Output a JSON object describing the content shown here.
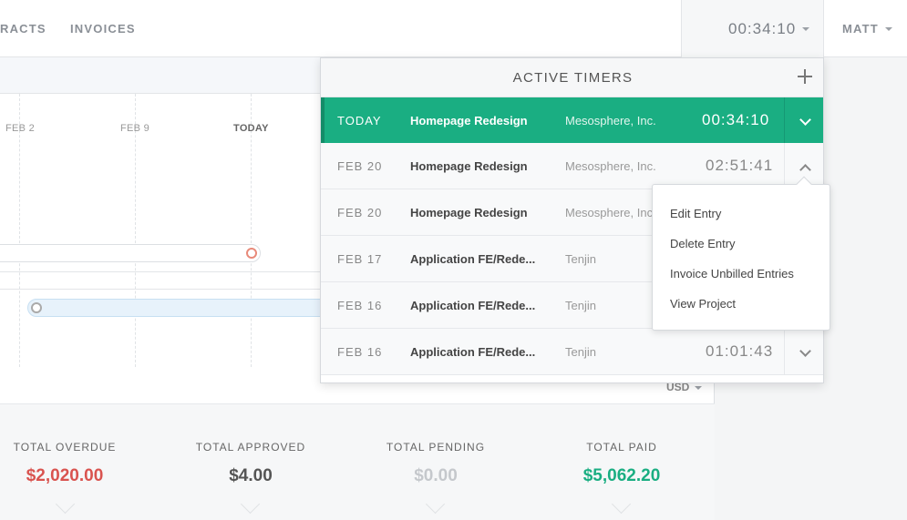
{
  "nav": {
    "contracts_label": "RACTS",
    "invoices_label": "INVOICES",
    "timer_value": "00:34:10",
    "user_label": "MATT"
  },
  "timeline": {
    "labels": [
      "FEB 2",
      "FEB 9",
      "TODAY"
    ]
  },
  "currency": "USD",
  "totals": [
    {
      "label": "TOTAL OVERDUE",
      "amount": "$2,020.00",
      "color": "#d9534f"
    },
    {
      "label": "TOTAL APPROVED",
      "amount": "$4.00",
      "color": "#555555"
    },
    {
      "label": "TOTAL PENDING",
      "amount": "$0.00",
      "color": "#c5c8cc"
    },
    {
      "label": "TOTAL PAID",
      "amount": "$5,062.20",
      "color": "#1aae82"
    }
  ],
  "panel": {
    "title": "ACTIVE TIMERS",
    "rows": [
      {
        "date": "TODAY",
        "project": "Homepage Redesign",
        "client": "Mesosphere, Inc.",
        "time": "00:34:10"
      },
      {
        "date": "FEB 20",
        "project": "Homepage Redesign",
        "client": "Mesosphere, Inc.",
        "time": "02:51:41"
      },
      {
        "date": "FEB 20",
        "project": "Homepage Redesign",
        "client": "Mesosphere, Inc",
        "time": ""
      },
      {
        "date": "FEB 17",
        "project": "Application FE/Rede...",
        "client": "Tenjin",
        "time": ""
      },
      {
        "date": "FEB 16",
        "project": "Application FE/Rede...",
        "client": "Tenjin",
        "time": ""
      },
      {
        "date": "FEB 16",
        "project": "Application FE/Rede...",
        "client": "Tenjin",
        "time": "01:01:43"
      }
    ]
  },
  "menu": {
    "items": [
      "Edit Entry",
      "Delete Entry",
      "Invoice Unbilled Entries",
      "View Project"
    ]
  },
  "colors": {
    "accent": "#1aae82",
    "overdue": "#d9534f"
  }
}
